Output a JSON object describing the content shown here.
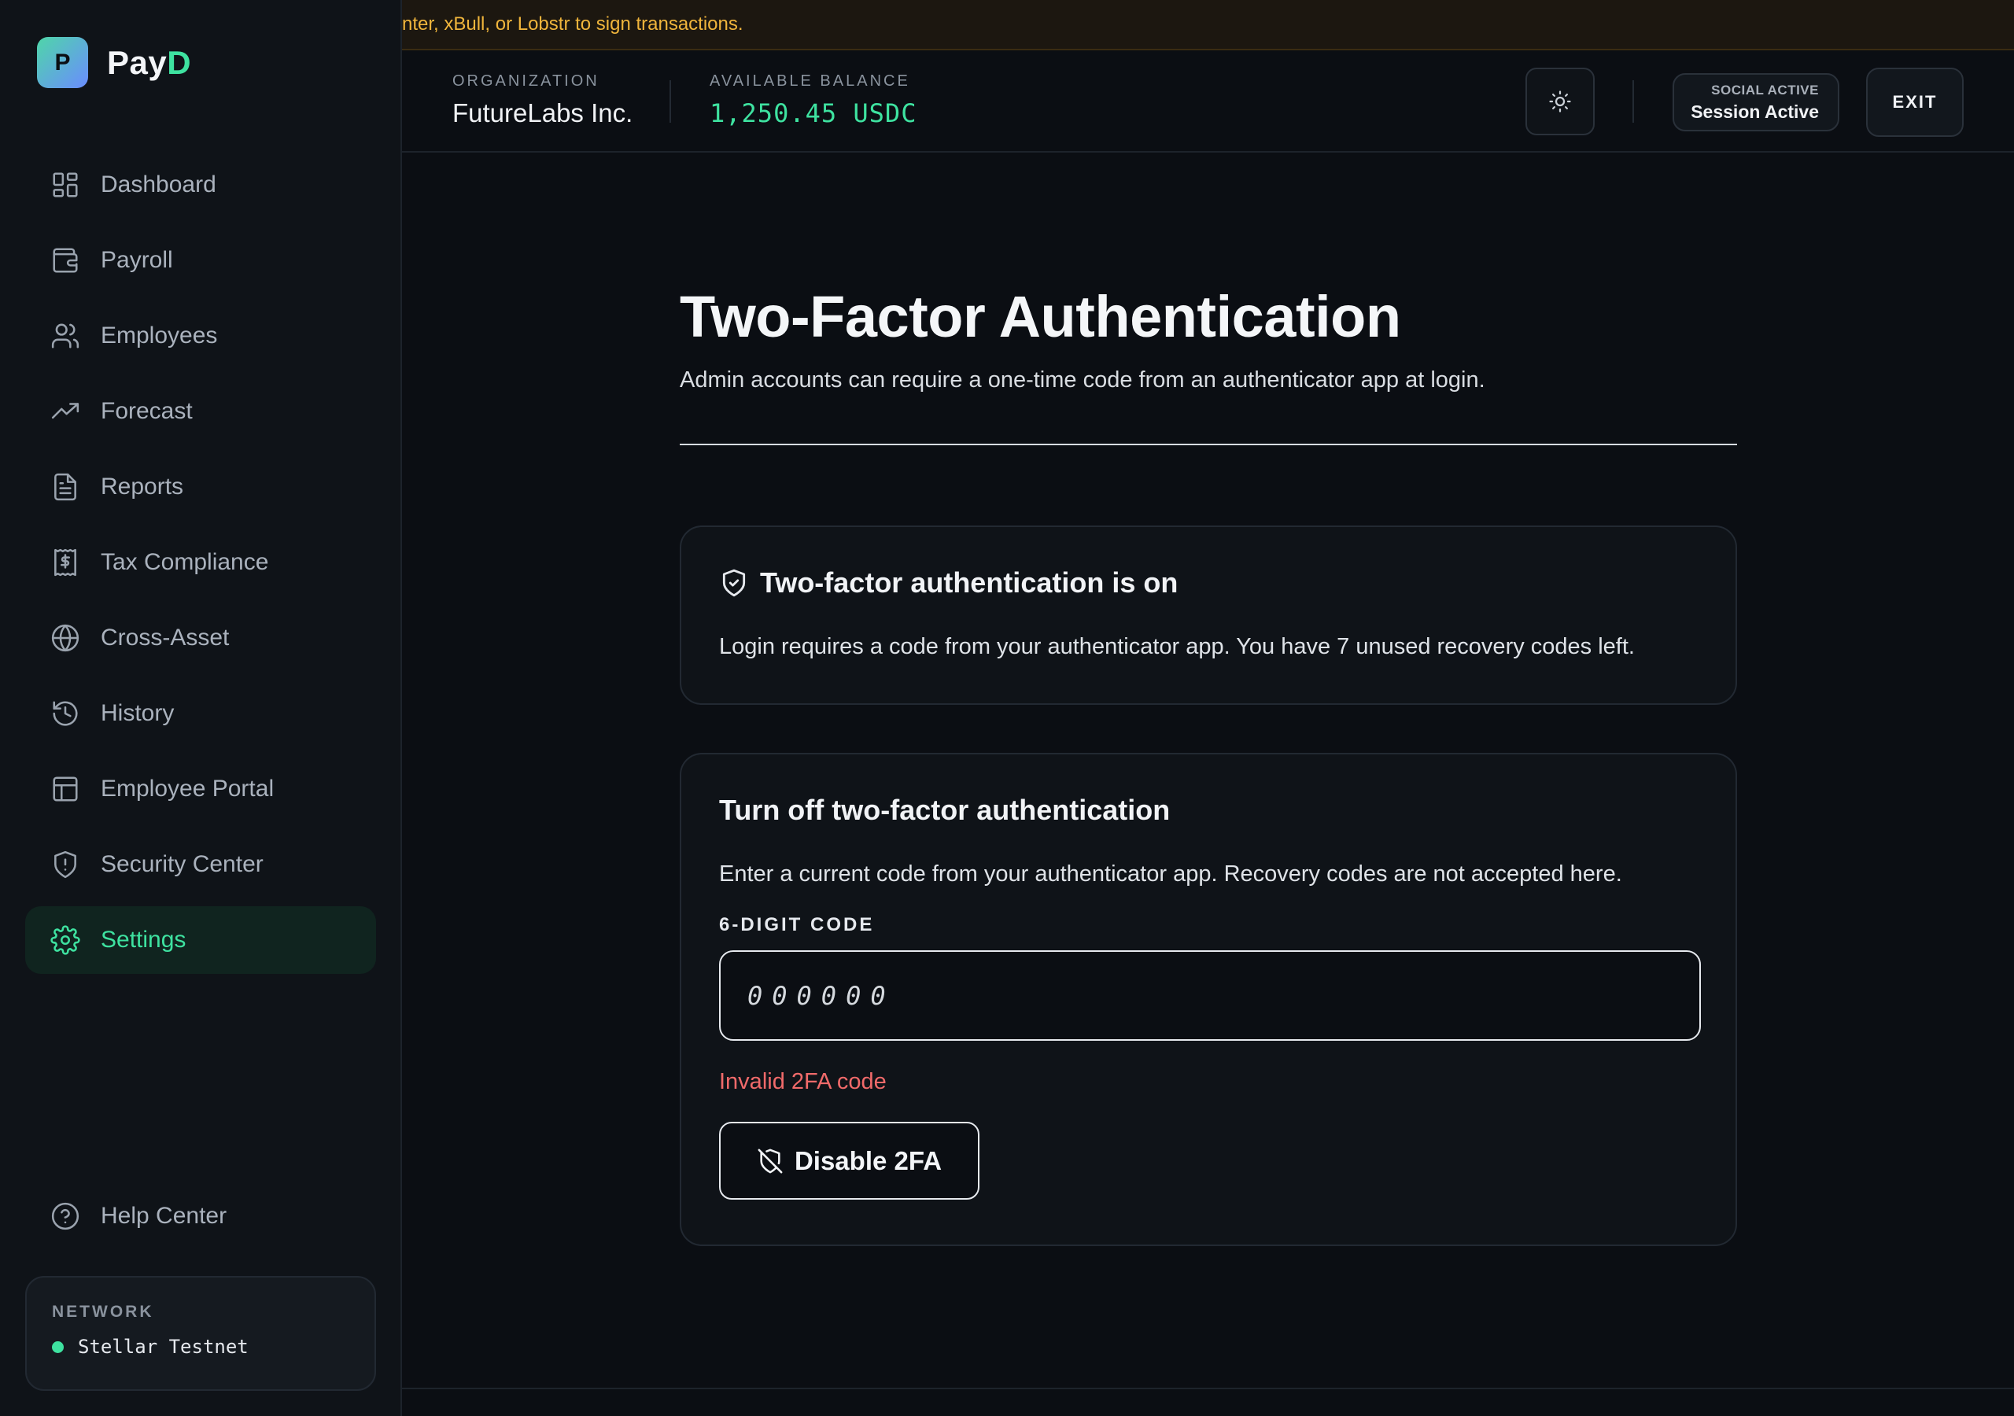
{
  "brand": {
    "initial": "P",
    "name_main": "Pay",
    "name_accent": "D"
  },
  "banner": {
    "text": "nter, xBull, or Lobstr to sign transactions."
  },
  "header": {
    "org_caption": "ORGANIZATION",
    "org_name": "FutureLabs Inc.",
    "balance_caption": "AVAILABLE BALANCE",
    "balance_value": "1,250.45 USDC",
    "session_line1": "SOCIAL ACTIVE",
    "session_line2": "Session Active",
    "exit_label": "EXIT"
  },
  "sidebar": {
    "items": [
      {
        "label": "Dashboard",
        "icon": "dashboard-icon"
      },
      {
        "label": "Payroll",
        "icon": "wallet-icon"
      },
      {
        "label": "Employees",
        "icon": "users-icon"
      },
      {
        "label": "Forecast",
        "icon": "trending-up-icon"
      },
      {
        "label": "Reports",
        "icon": "document-icon"
      },
      {
        "label": "Tax Compliance",
        "icon": "receipt-icon"
      },
      {
        "label": "Cross-Asset",
        "icon": "globe-icon"
      },
      {
        "label": "History",
        "icon": "history-icon"
      },
      {
        "label": "Employee Portal",
        "icon": "layout-icon"
      },
      {
        "label": "Security Center",
        "icon": "shield-alert-icon"
      },
      {
        "label": "Settings",
        "icon": "gear-icon",
        "active": true
      }
    ],
    "help_label": "Help Center",
    "network_caption": "NETWORK",
    "network_value": "Stellar Testnet"
  },
  "main": {
    "title": "Two-Factor Authentication",
    "subtitle": "Admin accounts can require a one-time code from an authenticator app at login.",
    "status_card": {
      "title": "Two-factor authentication is on",
      "text": "Login requires a code from your authenticator app. You have 7 unused recovery codes left."
    },
    "disable_card": {
      "title": "Turn off two-factor authentication",
      "text": "Enter a current code from your authenticator app. Recovery codes are not accepted here.",
      "field_label": "6-DIGIT CODE",
      "placeholder": "000000",
      "error": "Invalid 2FA code",
      "button_label": "Disable 2FA"
    }
  },
  "colors": {
    "accent": "#3ee2a0",
    "warning": "#f0b53c",
    "error": "#f06a6a",
    "background": "#0b0e13"
  }
}
